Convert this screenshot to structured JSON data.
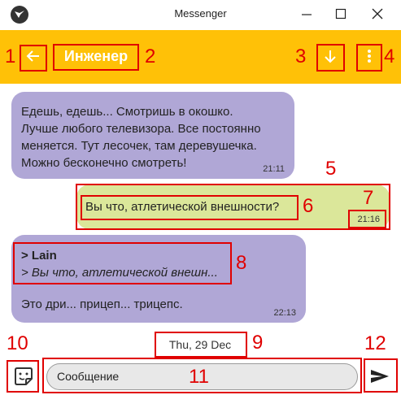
{
  "window": {
    "title": "Messenger"
  },
  "appbar": {
    "title": "Инженер"
  },
  "messages": [
    {
      "direction": "in",
      "text_lines": [
        "Едешь, едешь... Смотришь в окошко.",
        "Лучше любого телевизора. Все постоянно",
        "меняется. Тут лесочек, там деревушечка.",
        "Можно бесконечно смотреть!"
      ],
      "time": "21:11"
    },
    {
      "direction": "out",
      "text": "Вы что, атлетической внешности?",
      "time": "21:16"
    },
    {
      "direction": "in",
      "quote_author": "> Lain",
      "quote_text": "> Вы что, атлетической внешн...",
      "text": "Это дри... прицеп... трицепс.",
      "time": "22:13"
    }
  ],
  "date_chip": "Thu, 29 Dec",
  "composer": {
    "placeholder": "Сообщение"
  },
  "annotations": [
    "1",
    "2",
    "3",
    "4",
    "5",
    "6",
    "7",
    "8",
    "9",
    "10",
    "11",
    "12"
  ],
  "colors": {
    "appbar": "#ffc107",
    "incoming": "#b0a7d6",
    "outgoing": "#dbe79a",
    "annotation": "#e00000"
  }
}
